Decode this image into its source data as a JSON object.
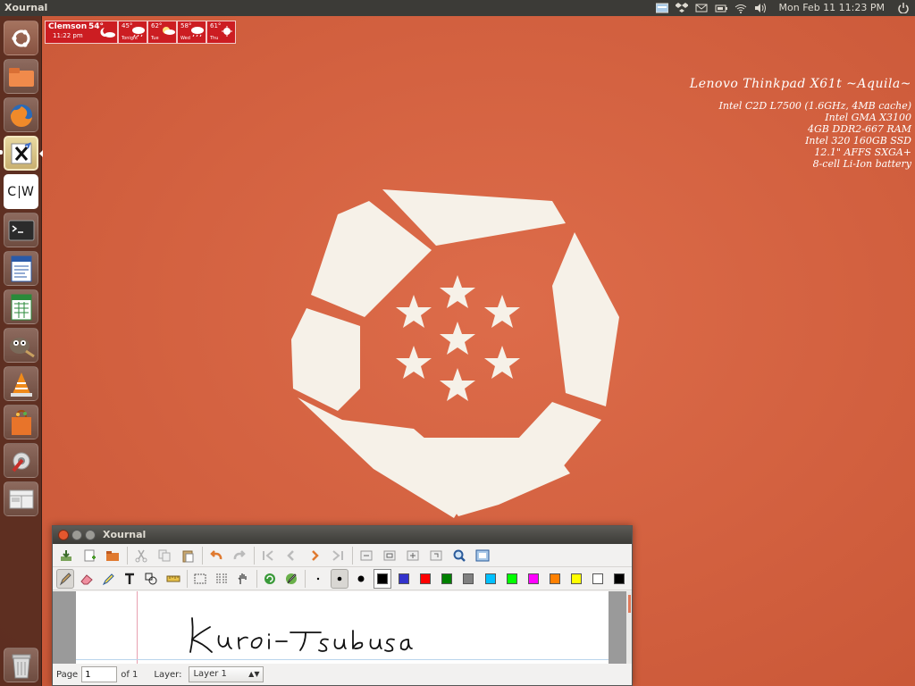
{
  "top_panel": {
    "app_title": "Xournal",
    "clock": "Mon Feb 11  11:23 PM",
    "tray_icons": [
      "keyboard-icon",
      "dropbox-icon",
      "mail-icon",
      "battery-icon",
      "wifi-icon",
      "volume-icon",
      "power-icon"
    ]
  },
  "launcher": {
    "items": [
      {
        "name": "dash-home",
        "icon": "ubuntu-logo-icon"
      },
      {
        "name": "files",
        "icon": "folder-icon"
      },
      {
        "name": "firefox",
        "icon": "firefox-icon"
      },
      {
        "name": "xournal",
        "icon": "xournal-icon",
        "active": true
      },
      {
        "name": "cw-app",
        "icon": "cw-icon",
        "label": "CW"
      },
      {
        "name": "terminal",
        "icon": "terminal-icon"
      },
      {
        "name": "writer",
        "icon": "document-icon"
      },
      {
        "name": "calc",
        "icon": "spreadsheet-icon"
      },
      {
        "name": "gimp",
        "icon": "gimp-icon"
      },
      {
        "name": "vlc",
        "icon": "vlc-cone-icon"
      },
      {
        "name": "software-center",
        "icon": "shopping-bag-icon"
      },
      {
        "name": "system-settings",
        "icon": "settings-icon"
      },
      {
        "name": "workspaces",
        "icon": "workspace-icon"
      },
      {
        "name": "trash",
        "icon": "trash-icon"
      }
    ]
  },
  "weather": {
    "city": "Clemson",
    "temp": "54°",
    "time": "11:22 pm",
    "forecast": [
      {
        "temp": "45°",
        "day": "Tonight"
      },
      {
        "temp": "62°",
        "day": "Tue"
      },
      {
        "temp": "58°",
        "day": "Wed"
      },
      {
        "temp": "61°",
        "day": "Thu"
      }
    ]
  },
  "sysinfo": {
    "title": "Lenovo Thinkpad X61t ~Aquila~",
    "lines": [
      "Intel C2D L7500 (1.6GHz, 4MB cache)",
      "Intel GMA X3100",
      "4GB DDR2-667 RAM",
      "Intel 320 160GB SSD",
      "12.1\" AFFS SXGA+",
      "8-cell Li-Ion battery"
    ]
  },
  "xournal": {
    "title": "Xournal",
    "colors": [
      "#000000",
      "#3333cc",
      "#ff0000",
      "#008000",
      "#808080",
      "#00c0ff",
      "#00ff00",
      "#ff00ff",
      "#ff8000",
      "#ffff00",
      "#ffffff",
      "#000000"
    ],
    "status": {
      "page_label": "Page",
      "page_value": "1",
      "of_label": "of 1",
      "layer_label": "Layer:",
      "layer_value": "Layer 1"
    },
    "handwriting": "Kuroi-Tsubasa"
  }
}
